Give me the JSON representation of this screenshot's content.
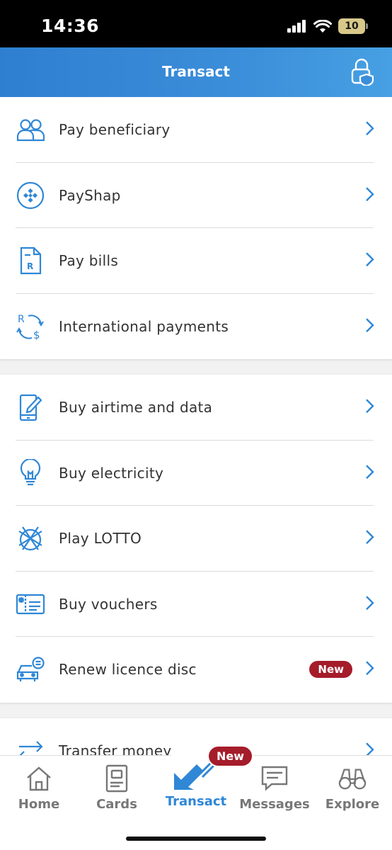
{
  "status_bar": {
    "time": "14:36",
    "battery": "10"
  },
  "header": {
    "title": "Transact"
  },
  "groups": [
    {
      "items": [
        {
          "label": "Pay beneficiary",
          "icon": "people-icon"
        },
        {
          "label": "PayShap",
          "icon": "payshap-icon"
        },
        {
          "label": "Pay bills",
          "icon": "bill-icon"
        },
        {
          "label": "International payments",
          "icon": "currency-exchange-icon"
        }
      ]
    },
    {
      "items": [
        {
          "label": "Buy airtime and data",
          "icon": "phone-icon"
        },
        {
          "label": "Buy electricity",
          "icon": "lightbulb-icon"
        },
        {
          "label": "Play LOTTO",
          "icon": "lotto-icon"
        },
        {
          "label": "Buy vouchers",
          "icon": "voucher-icon"
        },
        {
          "label": "Renew licence disc",
          "icon": "car-icon",
          "badge": "New"
        }
      ]
    },
    {
      "items": [
        {
          "label": "Transfer money",
          "icon": "transfer-icon"
        }
      ]
    }
  ],
  "tabbar": {
    "tabs": [
      {
        "label": "Home",
        "icon": "home-icon"
      },
      {
        "label": "Cards",
        "icon": "cards-icon"
      },
      {
        "label": "Transact",
        "icon": "transact-icon",
        "active": true
      },
      {
        "label": "Messages",
        "icon": "messages-icon"
      },
      {
        "label": "Explore",
        "icon": "binoculars-icon"
      }
    ],
    "badge": "New"
  },
  "colors": {
    "accent": "#2f87d6",
    "badge": "#a51c2a",
    "icon_blue": "#2f87d6"
  }
}
